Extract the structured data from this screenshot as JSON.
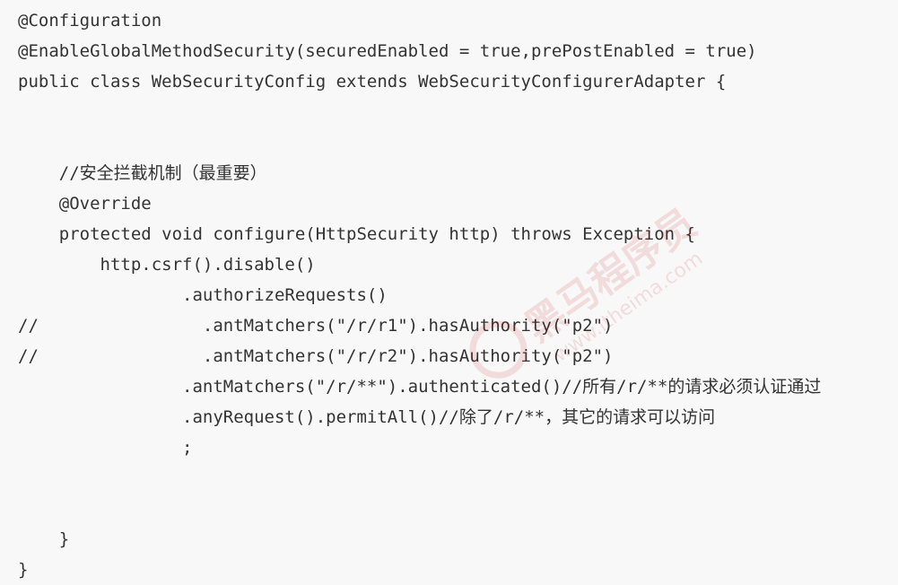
{
  "code_lines": [
    "@Configuration",
    "@EnableGlobalMethodSecurity(securedEnabled = true,prePostEnabled = true)",
    "public class WebSecurityConfig extends WebSecurityConfigurerAdapter {",
    "",
    "",
    "    //安全拦截机制（最重要）",
    "    @Override",
    "    protected void configure(HttpSecurity http) throws Exception {",
    "        http.csrf().disable()",
    "                .authorizeRequests()",
    "//                .antMatchers(\"/r/r1\").hasAuthority(\"p2\")",
    "//                .antMatchers(\"/r/r2\").hasAuthority(\"p2\")",
    "                .antMatchers(\"/r/**\").authenticated()//所有/r/**的请求必须认证通过",
    "                .anyRequest().permitAll()//除了/r/**，其它的请求可以访问",
    "                ;",
    "",
    "",
    "    }",
    "}"
  ],
  "watermark": {
    "brand_text": "黑马程序员",
    "site_text": "www.itheima.com",
    "icon": "itheima-logo-icon",
    "color": "#c00000"
  }
}
